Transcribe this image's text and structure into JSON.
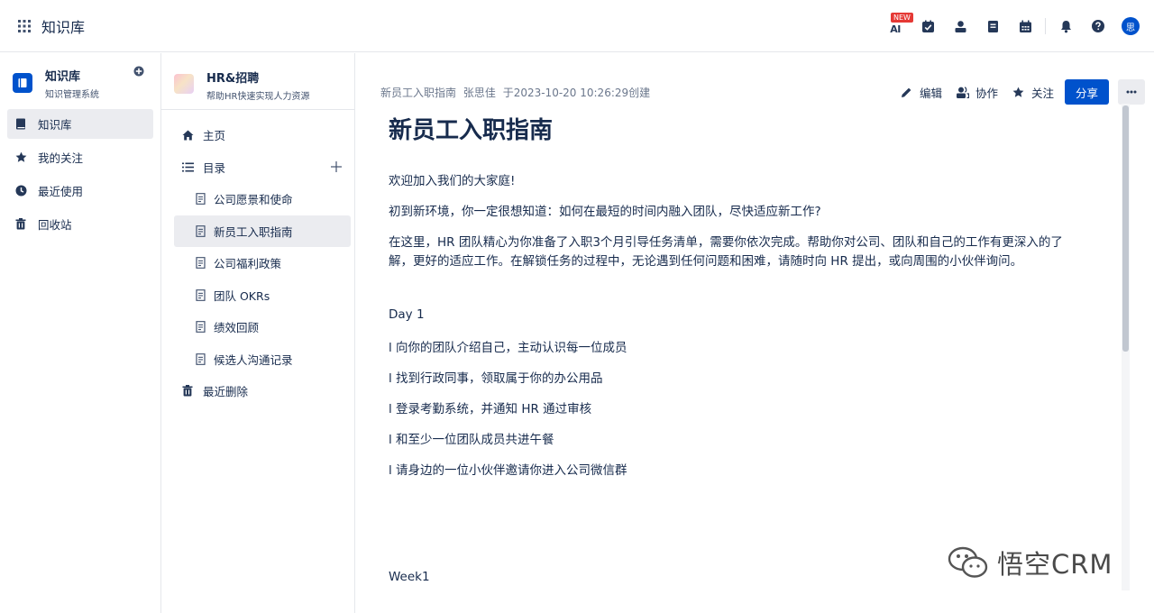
{
  "topbar": {
    "app_title": "知识库",
    "new_badge": "NEW",
    "ai_label": "AI",
    "avatar_text": "思"
  },
  "sidebar": {
    "space_title": "知识库",
    "space_subtitle": "知识管理系统",
    "items": [
      {
        "label": "知识库",
        "icon": "book-icon"
      },
      {
        "label": "我的关注",
        "icon": "star-icon"
      },
      {
        "label": "最近使用",
        "icon": "clock-icon"
      },
      {
        "label": "回收站",
        "icon": "trash-icon"
      }
    ]
  },
  "tree": {
    "space_title": "HR&招聘",
    "space_subtitle": "帮助HR快速实现人力资源",
    "home_label": "主页",
    "toc_label": "目录",
    "pages": [
      "公司愿景和使命",
      "新员工入职指南",
      "公司福利政策",
      "团队 OKRs",
      "绩效回顾",
      "候选人沟通记录"
    ],
    "deleted_label": "最近删除"
  },
  "page": {
    "breadcrumb": "新员工入职指南",
    "author": "张思佳",
    "created": "于2023-10-20 10:26:29创建",
    "actions": {
      "edit": "编辑",
      "collab": "协作",
      "follow": "关注",
      "share": "分享"
    },
    "title": "新员工入职指南",
    "paragraphs": [
      "欢迎加入我们的大家庭!",
      "初到新环境，你一定很想知道：如何在最短的时间内融入团队，尽快适应新工作?",
      "在这里，HR 团队精心为你准备了入职3个月引导任务清单，需要你依次完成。帮助你对公司、团队和自己的工作有更深入的了",
      "解，更好的适应工作。在解锁任务的过程中，无论遇到任何问题和困难，请随时向 HR 提出，或向周围的小伙伴询问。"
    ],
    "day1_heading": "Day 1",
    "day1_items": [
      "l  向你的团队介绍自己，主动认识每一位成员",
      "l  找到行政同事，领取属于你的办公用品",
      "l  登录考勤系统，并通知 HR 通过审核",
      "l  和至少一位团队成员共进午餐",
      "l  请身边的一位小伙伴邀请你进入公司微信群"
    ],
    "week1_heading": "Week1"
  },
  "watermark": "悟空CRM",
  "colors": {
    "accent": "#0052cc",
    "active_bg": "#ebecf0",
    "text": "#172b4d",
    "muted": "#6b778c",
    "badge": "#e53935"
  }
}
